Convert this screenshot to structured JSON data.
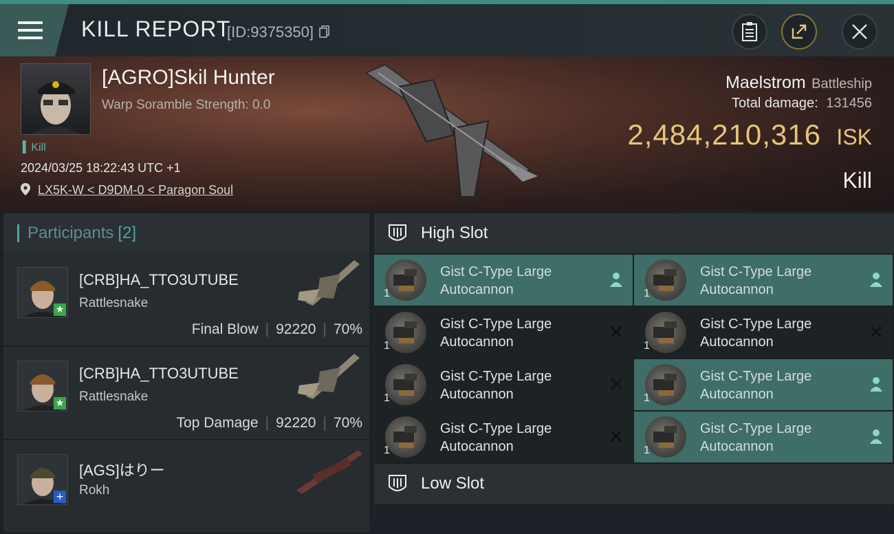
{
  "header": {
    "title": "KILL REPORT",
    "report_id": "[ID:9375350]"
  },
  "victim": {
    "name": "[AGRO]Skil Hunter",
    "warp_scramble": "Warp Soramble Strength: 0.0",
    "kill_tag": "Kill",
    "datetime": "2024/03/25 18:22:43 UTC +1",
    "location": "LX5K-W < D9DM-0 < Paragon Soul",
    "ship_name": "Maelstrom",
    "ship_class": "Battleship",
    "total_damage_label": "Total damage:",
    "total_damage": "131456",
    "isk_value": "2,484,210,316",
    "isk_unit": "ISK",
    "result": "Kill"
  },
  "participants": {
    "title": "Participants",
    "count": "[2]",
    "items": [
      {
        "name": "[CRB]HA_TTO3UTUBE",
        "ship": "Rattlesnake",
        "tag": "Final Blow",
        "damage": "92220",
        "percent": "70%",
        "badge": "star"
      },
      {
        "name": "[CRB]HA_TTO3UTUBE",
        "ship": "Rattlesnake",
        "tag": "Top Damage",
        "damage": "92220",
        "percent": "70%",
        "badge": "star"
      },
      {
        "name": "[AGS]はりー",
        "ship": "Rokh",
        "tag": "",
        "damage": "",
        "percent": "",
        "badge": "plus"
      }
    ]
  },
  "high_slot": {
    "title": "High Slot",
    "modules": [
      {
        "name": "Gist C-Type Large Autocannon",
        "qty": "1",
        "status": "fitted"
      },
      {
        "name": "Gist C-Type Large Autocannon",
        "qty": "1",
        "status": "fitted"
      },
      {
        "name": "Gist C-Type Large Autocannon",
        "qty": "1",
        "status": "destroyed"
      },
      {
        "name": "Gist C-Type Large Autocannon",
        "qty": "1",
        "status": "destroyed"
      },
      {
        "name": "Gist C-Type Large Autocannon",
        "qty": "1",
        "status": "destroyed"
      },
      {
        "name": "Gist C-Type Large Autocannon",
        "qty": "1",
        "status": "fitted"
      },
      {
        "name": "Gist C-Type Large Autocannon",
        "qty": "1",
        "status": "destroyed"
      },
      {
        "name": "Gist C-Type Large Autocannon",
        "qty": "1",
        "status": "fitted"
      }
    ]
  },
  "low_slot": {
    "title": "Low Slot"
  },
  "colors": {
    "accent": "#3f8c82",
    "isk": "#e8c47a",
    "fitted_bg": "#3f6d67"
  }
}
